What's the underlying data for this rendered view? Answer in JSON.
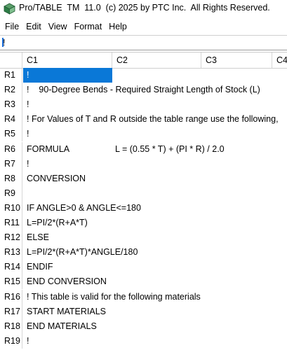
{
  "window": {
    "title": "Pro/TABLE  TM  11.0  (c) 2025 by PTC Inc.  All Rights Reserved."
  },
  "menu": [
    "File",
    "Edit",
    "View",
    "Format",
    "Help"
  ],
  "entry_line": {
    "value": "!"
  },
  "columns": [
    "C1",
    "C2",
    "C3",
    "C4"
  ],
  "rows": [
    {
      "label": "R1",
      "c1": "!",
      "c2": ""
    },
    {
      "label": "R2",
      "c1": "!    90-Degree Bends - Required Straight Length of Stock (L)",
      "c2": ""
    },
    {
      "label": "R3",
      "c1": "!",
      "c2": ""
    },
    {
      "label": "R4",
      "c1": "! For Values of T and R outside the table range use the following,",
      "c2": ""
    },
    {
      "label": "R5",
      "c1": "!",
      "c2": ""
    },
    {
      "label": "R6",
      "c1": "FORMULA",
      "c2": "L = (0.55 * T) + (PI * R) / 2.0"
    },
    {
      "label": "R7",
      "c1": "!",
      "c2": ""
    },
    {
      "label": "R8",
      "c1": "CONVERSION",
      "c2": ""
    },
    {
      "label": "R9",
      "c1": "",
      "c2": ""
    },
    {
      "label": "R10",
      "c1": "IF ANGLE>0 & ANGLE<=180",
      "c2": ""
    },
    {
      "label": "R11",
      "c1": "L=PI/2*(R+A*T)",
      "c2": ""
    },
    {
      "label": "R12",
      "c1": "ELSE",
      "c2": ""
    },
    {
      "label": "R13",
      "c1": "L=PI/2*(R+A*T)*ANGLE/180",
      "c2": ""
    },
    {
      "label": "R14",
      "c1": "ENDIF",
      "c2": ""
    },
    {
      "label": "R15",
      "c1": "END CONVERSION",
      "c2": ""
    },
    {
      "label": "R16",
      "c1": "! This table is valid for the following materials",
      "c2": ""
    },
    {
      "label": "R17",
      "c1": "START MATERIALS",
      "c2": ""
    },
    {
      "label": "R18",
      "c1": "END MATERIALS",
      "c2": ""
    },
    {
      "label": "R19",
      "c1": "!",
      "c2": ""
    }
  ],
  "selection": {
    "row": "R1",
    "column": "C1"
  },
  "colors": {
    "selection": "#0a78d7",
    "cursor": "#1e6fd9",
    "icon": "#2e8b57"
  },
  "icons": {
    "app": "pro-table-app-icon"
  }
}
